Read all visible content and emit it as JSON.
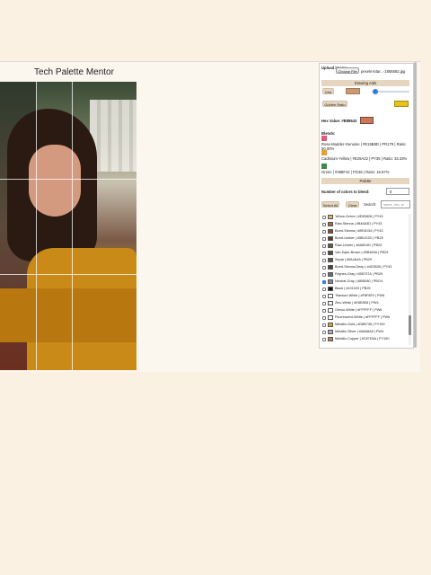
{
  "app_title": "Tech Palette Mentor",
  "upload": {
    "label": "Upload image:",
    "button": "Choose File",
    "filename": "pexels-lotar...-1855582.jpg"
  },
  "drawing_aids": {
    "header": "Drawing Aids",
    "grid_button": "Grid",
    "grid_color": "#c99a72",
    "slider_value_fraction": 0.05,
    "golden_ratio_button": "Golden Ratio",
    "golden_ratio_color": "#e6c21a"
  },
  "hex": {
    "label": "Hex Value: #B88643",
    "swatch_color": "#c9785a"
  },
  "blends": {
    "label": "Blends:",
    "items": [
      {
        "color": "#e05a78",
        "text": "Rose-Madder-Genuine | #E15B8D | PR179 | Ratio: 50.00%"
      },
      {
        "color": "#e6a22c",
        "text": "Cadmium-Yellow | #E29A22 | PY35 | Ratio: 33.33%"
      },
      {
        "color": "#3a8a4a",
        "text": "Green | #388F42 | PG36 | Ratio: 16.67%"
      }
    ]
  },
  "palette": {
    "header": "Palette",
    "num_colors_label": "Number of colors to blend:",
    "num_colors_value": "5",
    "select_all": "Select All",
    "clear": "Clear",
    "search_label": "Search:",
    "search_placeholder": "name, hex, pi",
    "items": [
      {
        "color": "#e0b83a",
        "checked": false,
        "text": "Yellow-Ochre | #E0B828 | PY43"
      },
      {
        "color": "#a8653a",
        "checked": false,
        "text": "Raw-Sienna | #B46A3D | PY43"
      },
      {
        "color": "#8a4a28",
        "checked": false,
        "text": "Burnt-Sienna | #8E4D34 | PY43"
      },
      {
        "color": "#5a3a28",
        "checked": false,
        "text": "Burnt-Umber | #5B2C2D | PB29"
      },
      {
        "color": "#6a5a3a",
        "checked": false,
        "text": "Raw-Umber | #6A5D4D | PB29"
      },
      {
        "color": "#5a4a3a",
        "checked": false,
        "text": "Van-Dyke-Brown | #5B483A | PB29"
      },
      {
        "color": "#6a4a3a",
        "checked": false,
        "text": "Sepia | #5A4A4A | PB29"
      },
      {
        "color": "#5a3a2a",
        "checked": false,
        "text": "Burnt-Sienna-Deep | #4D3535 | PY43"
      },
      {
        "color": "#6a6a7a",
        "checked": false,
        "text": "Paynes-Gray | #5B737A | PB29"
      },
      {
        "color": "#8a8a8a",
        "checked": true,
        "text": "Neutral-Gray | #808080 | PBO4"
      },
      {
        "color": "#151515",
        "checked": false,
        "text": "Black | #101020 | PB29"
      },
      {
        "color": "#ffffff",
        "checked": false,
        "text": "Titanium-White | #F8F8F0 | PW6"
      },
      {
        "color": "#f4f4f4",
        "checked": false,
        "text": "Zinc-White | #E8E8E8 | PW4"
      },
      {
        "color": "#ffffff",
        "checked": false,
        "text": "Gesso-White | #FFFFFF | PW6"
      },
      {
        "color": "#fbfbfb",
        "checked": false,
        "text": "Fluorescent-White | #FFFFFF | PW6"
      },
      {
        "color": "#d4a82c",
        "checked": false,
        "text": "Metallic-Gold | #D8B735 | PY150"
      },
      {
        "color": "#b0b0b0",
        "checked": false,
        "text": "Metallic-Silver | #A8A8A8 | PW4"
      },
      {
        "color": "#c87a5a",
        "checked": false,
        "text": "Metallic-Copper | #C87D5A | PY150"
      }
    ]
  }
}
